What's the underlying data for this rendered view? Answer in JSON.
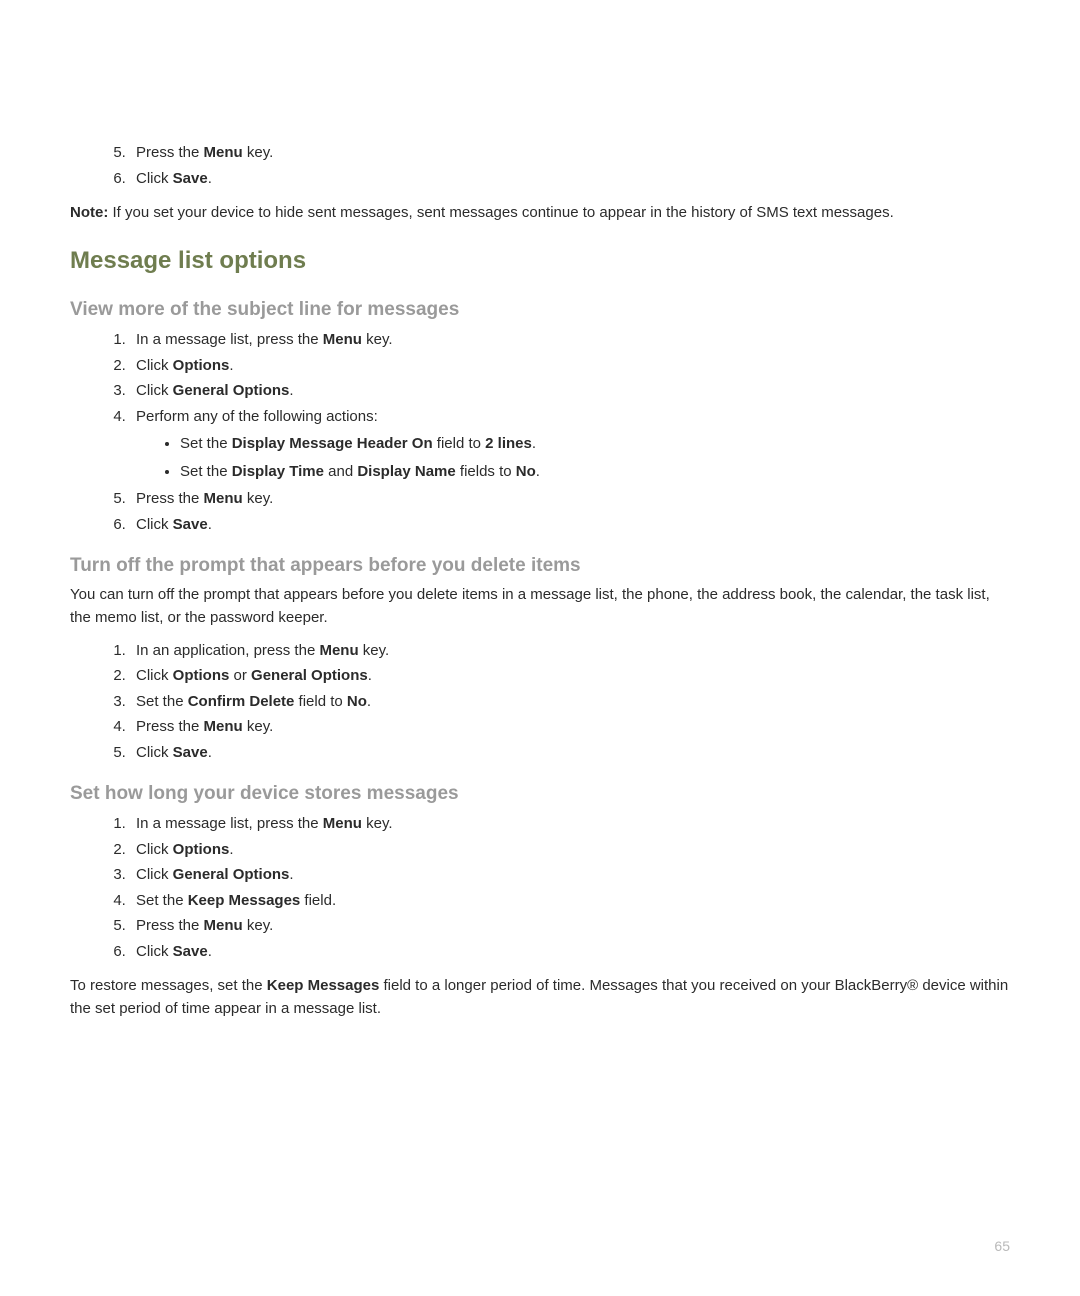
{
  "intro_tail": {
    "steps": [
      {
        "prefix": "Press the ",
        "bold": "Menu",
        "suffix": " key."
      },
      {
        "prefix": "Click ",
        "bold": "Save",
        "suffix": "."
      }
    ],
    "note_label": "Note:",
    "note_text": "  If you set your device to hide sent messages, sent messages continue to appear in the history of SMS text messages."
  },
  "section_title": "Message list options",
  "view_more": {
    "heading": "View more of the subject line for messages",
    "steps_before": [
      {
        "prefix": "In a message list, press the ",
        "bold": "Menu",
        "suffix": " key."
      },
      {
        "prefix": "Click ",
        "bold": "Options",
        "suffix": "."
      },
      {
        "prefix": "Click ",
        "bold": "General Options",
        "suffix": "."
      },
      {
        "text": "Perform any of the following actions:"
      }
    ],
    "sub_items": [
      {
        "pre": "Set the ",
        "b1": "Display Message Header On",
        "mid": " field to ",
        "b2": "2 lines",
        "post": "."
      },
      {
        "pre": "Set the ",
        "b1": "Display Time",
        "mid": " and ",
        "b2": "Display Name",
        "mid2": " fields to ",
        "b3": "No",
        "post": "."
      }
    ],
    "steps_after": [
      {
        "prefix": "Press the ",
        "bold": "Menu",
        "suffix": " key."
      },
      {
        "prefix": "Click ",
        "bold": "Save",
        "suffix": "."
      }
    ]
  },
  "turn_off": {
    "heading": "Turn off the prompt that appears before you delete items",
    "intro": "You can turn off the prompt that appears before you delete items in a message list, the phone, the address book, the calendar, the task list, the memo list, or the password keeper.",
    "steps": [
      {
        "prefix": "In an application, press the ",
        "bold": "Menu",
        "suffix": " key."
      },
      {
        "prefix": "Click ",
        "bold": "Options",
        "mid": " or ",
        "bold2": "General Options",
        "suffix": "."
      },
      {
        "prefix": "Set the ",
        "bold": "Confirm Delete",
        "mid": " field to ",
        "bold2": "No",
        "suffix": "."
      },
      {
        "prefix": "Press the ",
        "bold": "Menu",
        "suffix": " key."
      },
      {
        "prefix": "Click ",
        "bold": "Save",
        "suffix": "."
      }
    ]
  },
  "store": {
    "heading": "Set how long your device stores messages",
    "steps": [
      {
        "prefix": "In a message list, press the ",
        "bold": "Menu",
        "suffix": " key."
      },
      {
        "prefix": "Click ",
        "bold": "Options",
        "suffix": "."
      },
      {
        "prefix": "Click ",
        "bold": "General Options",
        "suffix": "."
      },
      {
        "prefix": "Set the ",
        "bold": "Keep Messages",
        "suffix": " field."
      },
      {
        "prefix": "Press the ",
        "bold": "Menu",
        "suffix": " key."
      },
      {
        "prefix": "Click ",
        "bold": "Save",
        "suffix": "."
      }
    ],
    "outro_pre": "To restore messages, set the ",
    "outro_bold": "Keep Messages",
    "outro_post": " field to a longer period of time. Messages that you received on your BlackBerry® device within the set period of time appear in a message list."
  },
  "page_number": "65"
}
